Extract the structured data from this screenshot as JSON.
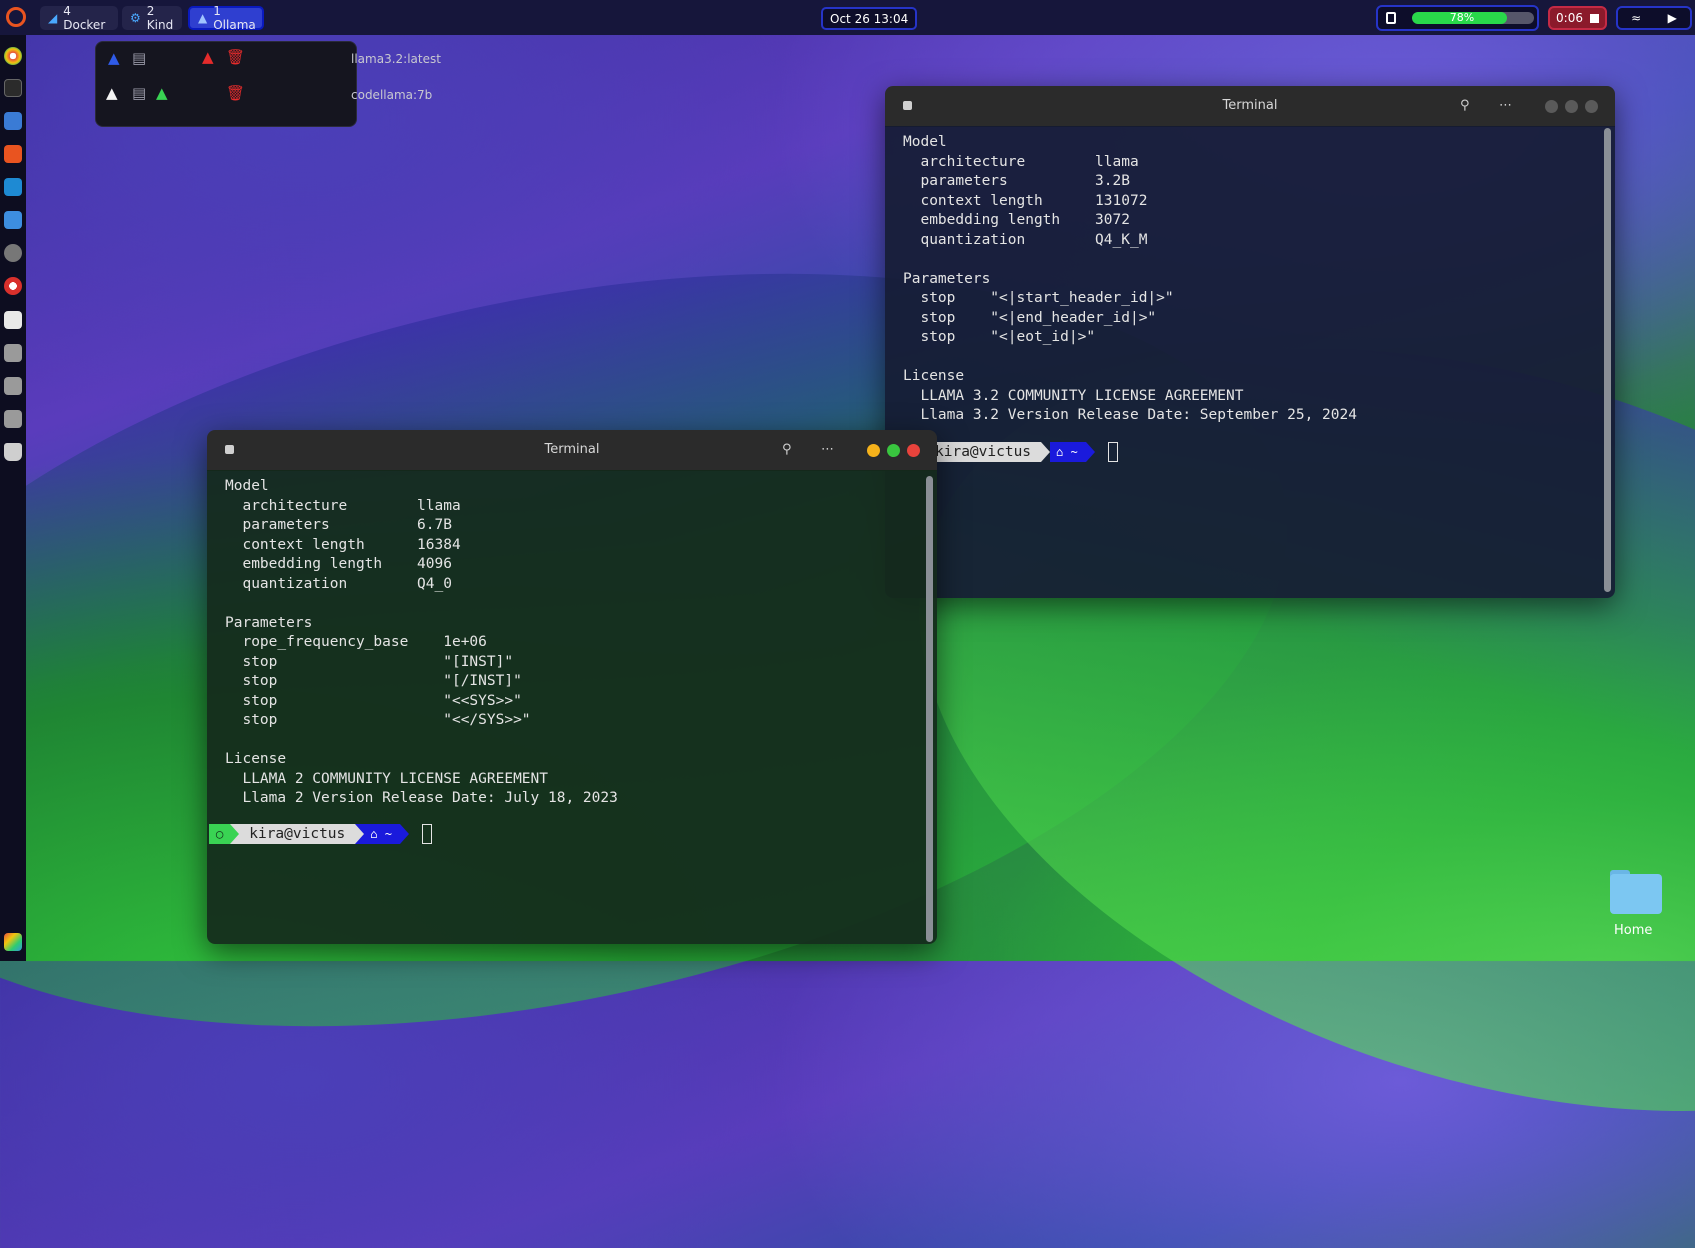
{
  "topbar": {
    "workspaces": [
      {
        "label": "4  Docker",
        "icon": "docker-icon"
      },
      {
        "label": "2  Kind",
        "icon": "kind-icon"
      },
      {
        "label": "1  Ollama",
        "icon": "ollama-icon"
      }
    ],
    "clock": "Oct 26  13:04",
    "battery": {
      "label": "78%",
      "percent": 78
    },
    "recording": "0:06"
  },
  "ollama_menu": {
    "models": [
      "llama3.2:latest",
      "codellama:7b"
    ]
  },
  "terminal_back": {
    "title": "Terminal",
    "lines": [
      "Model",
      "  architecture        llama",
      "  parameters          3.2B",
      "  context length      131072",
      "  embedding length    3072",
      "  quantization        Q4_K_M",
      "",
      "Parameters",
      "  stop    \"<|start_header_id|>\"",
      "  stop    \"<|end_header_id|>\"",
      "  stop    \"<|eot_id|>\"",
      "",
      "License",
      "  LLAMA 3.2 COMMUNITY LICENSE AGREEMENT",
      "  Llama 3.2 Version Release Date: September 25, 2024"
    ],
    "prompt_user": "kira@victus",
    "prompt_dir": "~"
  },
  "terminal_front": {
    "title": "Terminal",
    "lines": [
      "Model",
      "  architecture        llama",
      "  parameters          6.7B",
      "  context length      16384",
      "  embedding length    4096",
      "  quantization        Q4_0",
      "",
      "Parameters",
      "  rope_frequency_base    1e+06",
      "  stop                   \"[INST]\"",
      "  stop                   \"[/INST]\"",
      "  stop                   \"<<SYS>>\"",
      "  stop                   \"<</SYS>>\"",
      "",
      "License",
      "  LLAMA 2 COMMUNITY LICENSE AGREEMENT",
      "  Llama 2 Version Release Date: July 18, 2023"
    ],
    "prompt_user": "kira@victus",
    "prompt_dir": "~"
  },
  "desktop": {
    "home_label": "Home"
  },
  "colors": {
    "accent": "#2634c8",
    "battery_fill": "#29d84a",
    "record": "#8b1a2b"
  }
}
